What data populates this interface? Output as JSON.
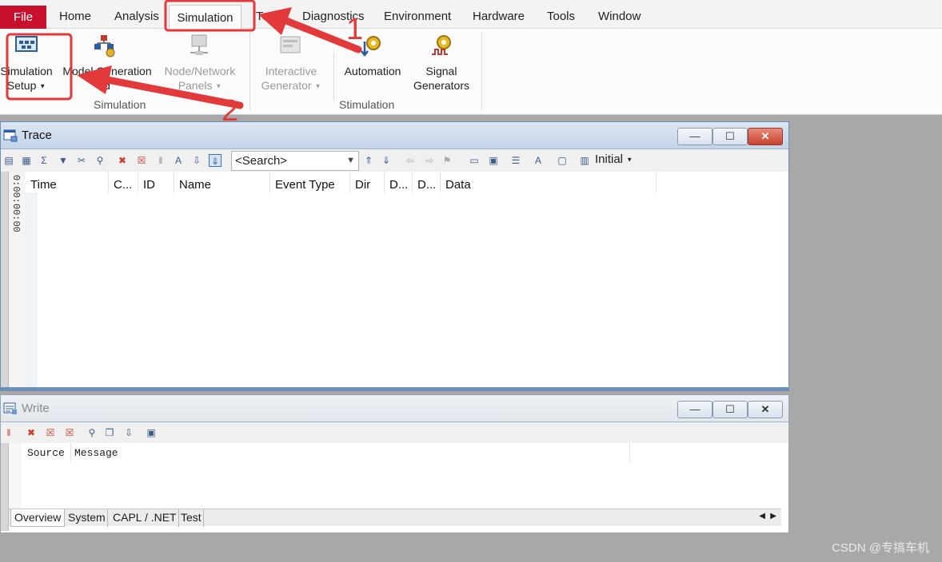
{
  "menu": {
    "file": "File",
    "items": [
      "Home",
      "Analysis",
      "Simulation",
      "Test",
      "Diagnostics",
      "Environment",
      "Hardware",
      "Tools",
      "Window"
    ]
  },
  "ribbon": {
    "buttons": [
      {
        "line1": "Simulation",
        "line2": "Setup",
        "icon": "simulation-setup-icon"
      },
      {
        "line1": "Model Generation",
        "line2": "d",
        "icon": "model-generation-icon"
      },
      {
        "line1": "Node/Network",
        "line2": "Panels",
        "icon": "node-network-panels-icon"
      },
      {
        "line1": "Interactive",
        "line2": "Generator",
        "icon": "interactive-generator-icon"
      },
      {
        "line1": "Automation",
        "line2": "",
        "icon": "automation-icon"
      },
      {
        "line1": "Signal",
        "line2": "Generators",
        "icon": "signal-generators-icon"
      }
    ],
    "groups": [
      "Simulation",
      "Stimulation"
    ]
  },
  "annotations": {
    "arrow1": "1",
    "arrow2": "2",
    "accent": "#e23a3a"
  },
  "trace": {
    "title": "Trace",
    "search_placeholder": "<Search>",
    "initial_label": "Initial",
    "time_label": "0:00:00:00",
    "columns": [
      "Time",
      "C...",
      "ID",
      "Name",
      "Event Type",
      "Dir",
      "D...",
      "D...",
      "Data"
    ]
  },
  "write": {
    "title": "Write",
    "columns": [
      "Source",
      "Message"
    ],
    "tabs": [
      "Overview",
      "System",
      "CAPL / .NET",
      "Test"
    ]
  },
  "watermark": "CSDN @专搞车机"
}
